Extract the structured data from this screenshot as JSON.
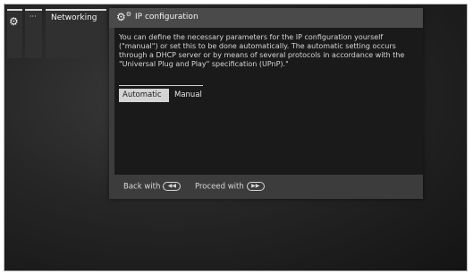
{
  "sidebar": {
    "gear_icon": "gear-icon",
    "more_label": "···",
    "networking_label": "Networking"
  },
  "dialog": {
    "icon": "settings-gears-icon",
    "title": "IP configuration",
    "description": "You can define the necessary parameters for the IP configuration yourself (\"manual\") or set this to be done automatically. The automatic setting occurs through a DHCP server or by means of several protocols in accordance with the \"Universal Plug and Play\" specification (UPnP).\"",
    "options": [
      {
        "label": "Automatic",
        "selected": true
      },
      {
        "label": "Manual",
        "selected": false
      }
    ],
    "footer": {
      "back_label": "Back with",
      "back_key": "rewind-key-icon",
      "proceed_label": "Proceed with",
      "proceed_key": "fast-forward-key-icon"
    }
  },
  "colors": {
    "background": "#1f1f1f",
    "dialog": "#3c3c3c",
    "selected_option": "#d4d4d4"
  }
}
